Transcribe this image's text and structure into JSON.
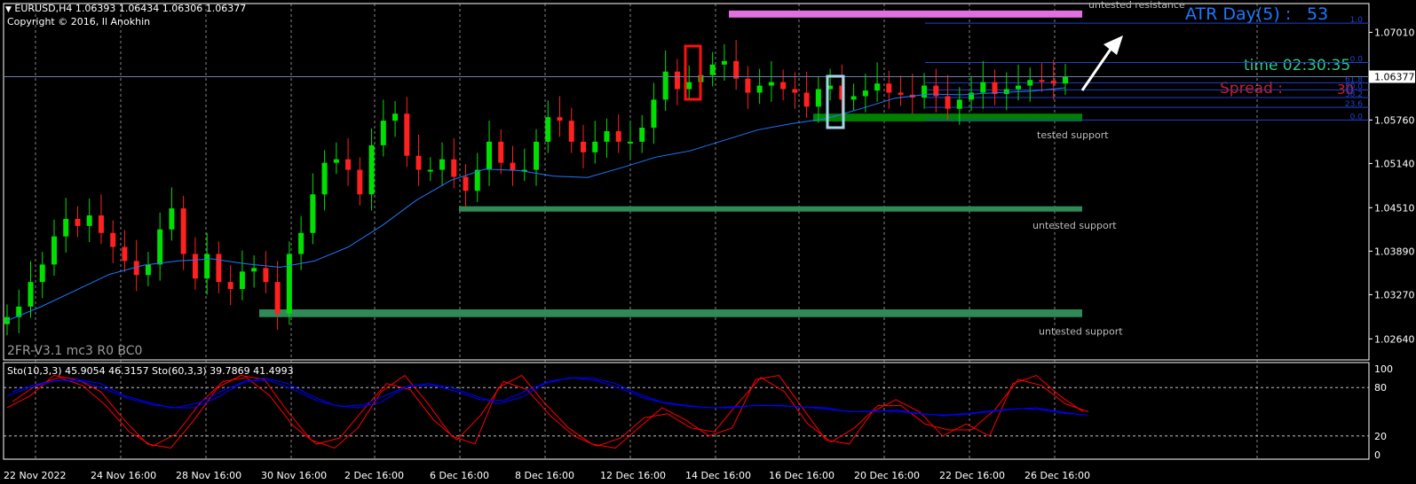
{
  "header": {
    "symbol_line": "EURUSD,H4  1.06393 1.06434 1.06306 1.06377",
    "copyright": "Copyright © 2016, Il Anokhin"
  },
  "indicator_label": "2FR-V3.1 mc3 R0 BC0",
  "atr": {
    "label": "ATR Day(5) :",
    "value": "53"
  },
  "time_label": "time 02:30:35",
  "spread": {
    "label": "Spread :",
    "value": "30"
  },
  "current_price_label": "1.06377",
  "zone_labels": {
    "resistance": "untested resistance",
    "support_tested": "tested support",
    "support_mid": "untested support",
    "support_low": "untested support"
  },
  "fib_labels": [
    "1.0",
    "0.0",
    "61.8",
    "50.0",
    "38.2",
    "23.6",
    "0.0"
  ],
  "sub_header": "Sto(10,3,3) 45.9054 46.3157  Sto(60,3,3) 39.7869 41.4993",
  "colors": {
    "bull": "#00e000",
    "bear": "#ff2020",
    "ma": "#1e78ff",
    "resistance": "#e070e0",
    "support_tested": "#008000",
    "support_untested": "#2e8b57",
    "sto_fast": "#ff0000",
    "sto_slow": "#0000ff"
  },
  "chart_data": {
    "type": "candlestick",
    "symbol": "EURUSD",
    "timeframe": "H4",
    "ohlc_last": {
      "open": 1.06393,
      "high": 1.06434,
      "low": 1.06306,
      "close": 1.06377
    },
    "ylim": [
      1.0234,
      1.0742
    ],
    "y_ticks": [
      "1.07010",
      "1.06377",
      "1.05760",
      "1.05140",
      "1.04510",
      "1.03890",
      "1.03270",
      "1.02640"
    ],
    "x_ticks": [
      "22 Nov 2022",
      "24 Nov 16:00",
      "28 Nov 16:00",
      "30 Nov 16:00",
      "2 Dec 16:00",
      "6 Dec 16:00",
      "8 Dec 16:00",
      "12 Dec 16:00",
      "14 Dec 16:00",
      "16 Dec 16:00",
      "20 Dec 16:00",
      "22 Dec 16:00",
      "26 Dec 16:00"
    ],
    "close_path": [
      1.0295,
      1.031,
      1.0345,
      1.037,
      1.041,
      1.0435,
      1.0425,
      1.044,
      1.0415,
      1.0395,
      1.0375,
      1.0355,
      1.037,
      1.042,
      1.045,
      1.0385,
      1.035,
      1.0385,
      1.0345,
      1.0335,
      1.036,
      1.0365,
      1.0345,
      1.03,
      1.0385,
      1.0415,
      1.047,
      1.0515,
      1.052,
      1.0505,
      1.047,
      1.054,
      1.0575,
      1.0585,
      1.0525,
      1.0505,
      1.0505,
      1.052,
      1.0495,
      1.0475,
      1.0505,
      1.0545,
      1.0515,
      1.0505,
      1.0505,
      1.0545,
      1.058,
      1.0575,
      1.0545,
      1.053,
      1.0545,
      1.056,
      1.0545,
      1.0545,
      1.0565,
      1.0605,
      1.0645,
      1.062,
      1.063,
      1.064,
      1.0655,
      1.066,
      1.0635,
      1.0615,
      1.0625,
      1.063,
      1.062,
      1.0615,
      1.0595,
      1.062,
      1.0625,
      1.0605,
      1.061,
      1.0618,
      1.0628,
      1.0615,
      1.0612,
      1.0608,
      1.0625,
      1.061,
      1.0592,
      1.0605,
      1.0615,
      1.063,
      1.0613,
      1.062,
      1.0625,
      1.0633,
      1.0632,
      1.0628,
      1.0638
    ],
    "ma_path": [
      1.029,
      1.031,
      1.0333,
      1.0356,
      1.0369,
      1.0375,
      1.0378,
      1.0371,
      1.0366,
      1.0375,
      1.0395,
      1.0426,
      1.0462,
      1.049,
      1.0506,
      1.0504,
      1.0496,
      1.0494,
      1.0508,
      1.0523,
      1.0532,
      1.0547,
      1.0562,
      1.0571,
      1.0578,
      1.0592,
      1.0607,
      1.0613,
      1.0612,
      1.0615,
      1.0617,
      1.0622
    ],
    "zones": [
      {
        "name": "untested resistance",
        "low": 1.0722,
        "high": 1.0732
      },
      {
        "name": "tested support",
        "low": 1.0574,
        "high": 1.0585
      },
      {
        "name": "untested support",
        "low": 1.0446,
        "high": 1.0453
      },
      {
        "name": "untested support",
        "low": 1.0295,
        "high": 1.0306
      }
    ],
    "fib_levels": [
      {
        "label": "1.0",
        "price": 1.0714
      },
      {
        "label": "0.0",
        "price": 1.0658
      },
      {
        "label": "61.8",
        "price": 1.0629
      },
      {
        "label": "50.0",
        "price": 1.0619
      },
      {
        "label": "38.2",
        "price": 1.0608
      },
      {
        "label": "23.6",
        "price": 1.0594
      },
      {
        "label": "0.0",
        "price": 1.0576
      }
    ],
    "stochastic": {
      "ylim": [
        0,
        100
      ],
      "levels": [
        20,
        80
      ],
      "sto_10_3_3": [
        55,
        70,
        95,
        90,
        75,
        40,
        10,
        5,
        40,
        80,
        95,
        90,
        50,
        15,
        5,
        30,
        75,
        95,
        60,
        20,
        10,
        80,
        95,
        60,
        30,
        10,
        5,
        30,
        55,
        40,
        20,
        30,
        90,
        95,
        55,
        15,
        10,
        50,
        65,
        50,
        20,
        35,
        20,
        85,
        95,
        70,
        50
      ],
      "sto_60_3_3": [
        70,
        80,
        88,
        90,
        85,
        70,
        62,
        55,
        55,
        68,
        85,
        92,
        85,
        70,
        58,
        55,
        62,
        80,
        85,
        80,
        70,
        60,
        68,
        85,
        92,
        92,
        85,
        72,
        62,
        58,
        55,
        55,
        58,
        58,
        56,
        55,
        50,
        50,
        52,
        48,
        45,
        47,
        50,
        53,
        55,
        50,
        46
      ]
    }
  }
}
